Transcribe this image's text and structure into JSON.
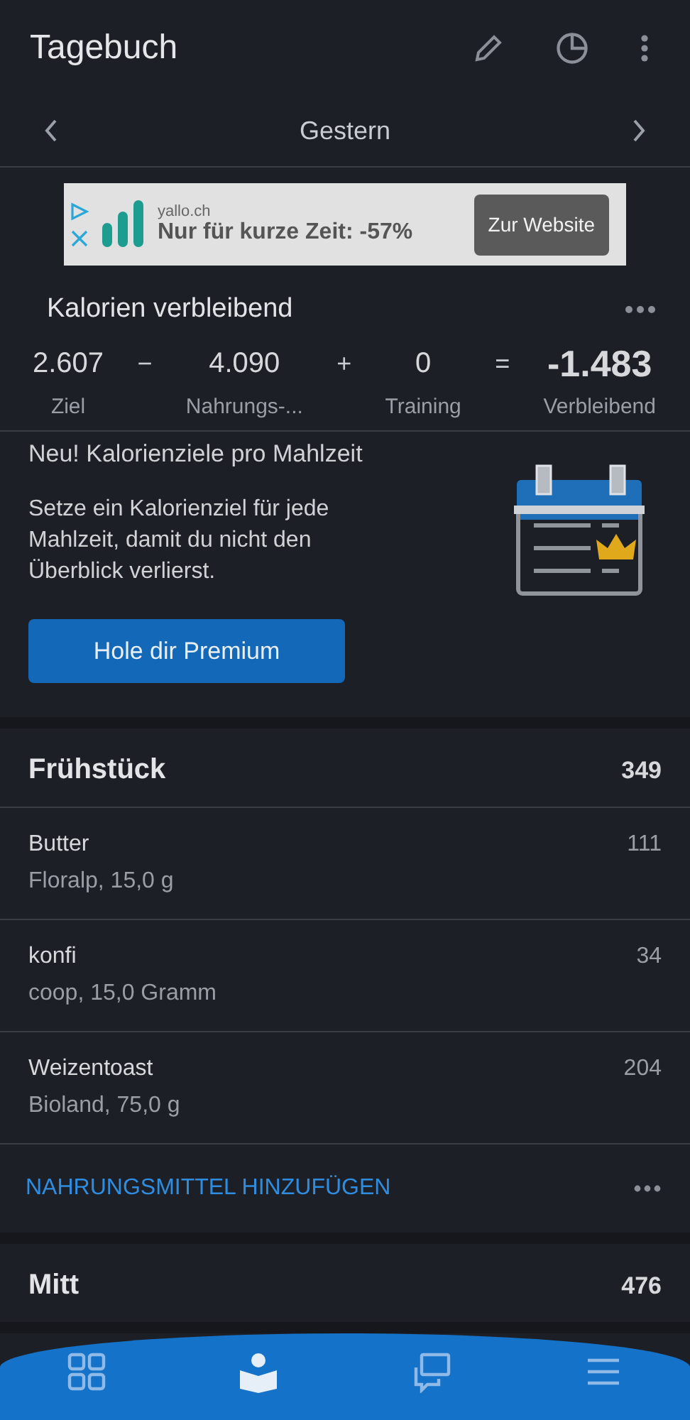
{
  "app_bar": {
    "title": "Tagebuch"
  },
  "date_nav": {
    "label": "Gestern"
  },
  "ad": {
    "domain": "yallo.ch",
    "headline": "Nur für kurze Zeit: -57%",
    "button": "Zur Website"
  },
  "calories": {
    "title": "Kalorien verbleibend",
    "terms": [
      {
        "value": "2.607",
        "label": "Ziel",
        "op": "−"
      },
      {
        "value": "4.090",
        "label": "Nahrungs-...",
        "op": "+"
      },
      {
        "value": "0",
        "label": "Training",
        "op": "="
      },
      {
        "value": "-1.483",
        "label": "Verbleibend"
      }
    ]
  },
  "promo": {
    "title": "Neu! Kalorienziele pro Mahlzeit",
    "text": "Setze ein Kalorienziel für jede Mahlzeit, damit du nicht den Überblick verlierst.",
    "button": "Hole dir Premium"
  },
  "meals": [
    {
      "name": "Frühstück",
      "total": "349",
      "items": [
        {
          "name": "Butter",
          "detail": "Floralp, 15,0 g",
          "calories": "111"
        },
        {
          "name": "konfi",
          "detail": "coop, 15,0 Gramm",
          "calories": "34"
        },
        {
          "name": "Weizentoast",
          "detail": "Bioland, 75,0 g",
          "calories": "204"
        }
      ],
      "add_label": "NAHRUNGSMITTEL HINZUFÜGEN"
    },
    {
      "name": "Mitt",
      "total": "476"
    }
  ],
  "bottom_nav": [
    {
      "kind": "dashboard",
      "selected": false
    },
    {
      "kind": "diary",
      "selected": true
    },
    {
      "kind": "newsfeed",
      "selected": false
    },
    {
      "kind": "more",
      "selected": false
    }
  ]
}
